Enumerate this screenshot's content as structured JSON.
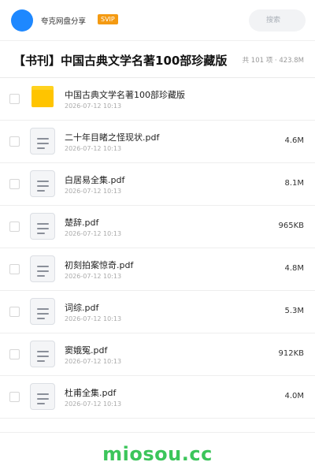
{
  "header": {
    "user_name": "夸克网盘分享",
    "badge": "SVIP",
    "search_placeholder": "搜索"
  },
  "share": {
    "title": "【书刊】中国古典文学名著100部珍藏版",
    "summary": "共 101 项 · 423.8M"
  },
  "files": [
    {
      "name": "中国古典文学名著100部珍藏版",
      "date": "2026-07-12 10:13",
      "size": "",
      "type": "folder"
    },
    {
      "name": "二十年目睹之怪现状.pdf",
      "date": "2026-07-12 10:13",
      "size": "4.6M",
      "type": "pdf"
    },
    {
      "name": "白居易全集.pdf",
      "date": "2026-07-12 10:13",
      "size": "8.1M",
      "type": "pdf"
    },
    {
      "name": "楚辞.pdf",
      "date": "2026-07-12 10:13",
      "size": "965KB",
      "type": "pdf"
    },
    {
      "name": "初刻拍案惊奇.pdf",
      "date": "2026-07-12 10:13",
      "size": "4.8M",
      "type": "pdf"
    },
    {
      "name": "词综.pdf",
      "date": "2026-07-12 10:13",
      "size": "5.3M",
      "type": "pdf"
    },
    {
      "name": "窦娥冤.pdf",
      "date": "2026-07-12 10:13",
      "size": "912KB",
      "type": "pdf"
    },
    {
      "name": "杜甫全集.pdf",
      "date": "2026-07-12 10:13",
      "size": "4.0M",
      "type": "pdf"
    }
  ],
  "watermark": "miosou.cc",
  "colors": {
    "avatar": "#1e88ff",
    "svip_badge": "#f49a12",
    "folder": "#ffc400",
    "watermark": "#3cc55b"
  },
  "icons": {
    "folder": "folder-icon",
    "pdf": "file-icon"
  }
}
